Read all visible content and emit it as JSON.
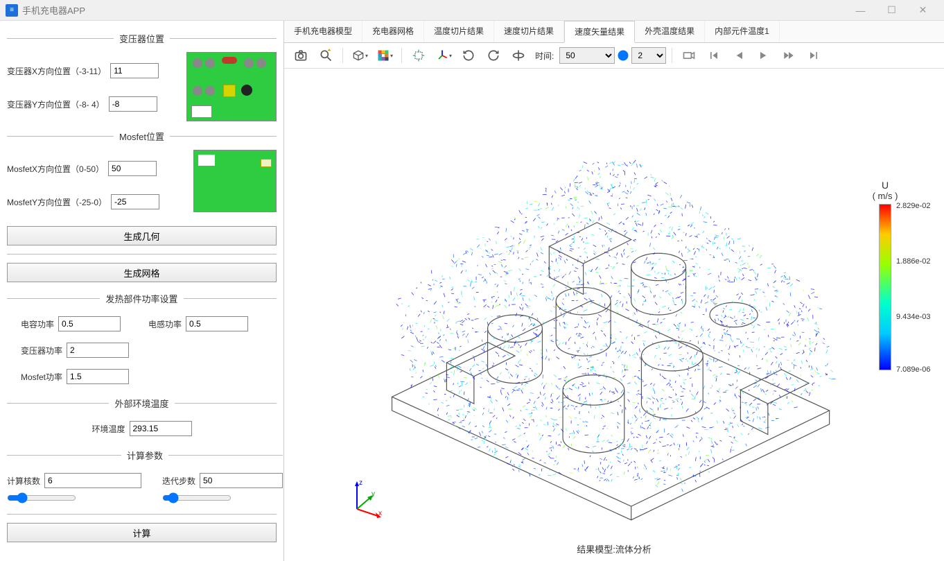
{
  "window": {
    "title": "手机充电器APP",
    "icon_glyph": "≡"
  },
  "sidebar": {
    "transformer_section": "变压器位置",
    "trans_x_label": "变压器X方向位置（-3-11）",
    "trans_x_value": "11",
    "trans_y_label": "变压器Y方向位置（-8- 4）",
    "trans_y_value": "-8",
    "mosfet_section": "Mosfet位置",
    "mosfet_x_label": "MosfetX方向位置（0-50）",
    "mosfet_x_value": "50",
    "mosfet_y_label": "MosfetY方向位置（-25-0）",
    "mosfet_y_value": "-25",
    "gen_geom_btn": "生成几何",
    "gen_mesh_btn": "生成网格",
    "power_section": "发热部件功率设置",
    "power_items": {
      "cap_label": "电容功率",
      "cap_value": "0.5",
      "ind_label": "电感功率",
      "ind_value": "0.5",
      "trans_label": "变压器功率",
      "trans_value": "2",
      "mosfet_label": "Mosfet功率",
      "mosfet_value": "1.5"
    },
    "env_section": "外部环境温度",
    "env_label": "环境温度",
    "env_value": "293.15",
    "calc_section": "计算参数",
    "cores_label": "计算核数",
    "cores_value": "6",
    "iters_label": "迭代步数",
    "iters_value": "50",
    "calc_btn": "计算"
  },
  "tabs": [
    "手机充电器模型",
    "充电器网格",
    "温度切片结果",
    "速度切片结果",
    "速度矢量结果",
    "外壳温度结果",
    "内部元件温度1"
  ],
  "active_tab_index": 4,
  "toolbar": {
    "time_label": "时间:",
    "time_value": "50",
    "step_value": "2"
  },
  "colorbar": {
    "title": "U",
    "unit": "( m/s )",
    "ticks": [
      "2.829e-02",
      "1.886e-02",
      "9.434e-03",
      "7.089e-06"
    ]
  },
  "footer": "结果模型:流体分析",
  "axis_labels": {
    "x": "x",
    "y": "y",
    "z": "z"
  }
}
